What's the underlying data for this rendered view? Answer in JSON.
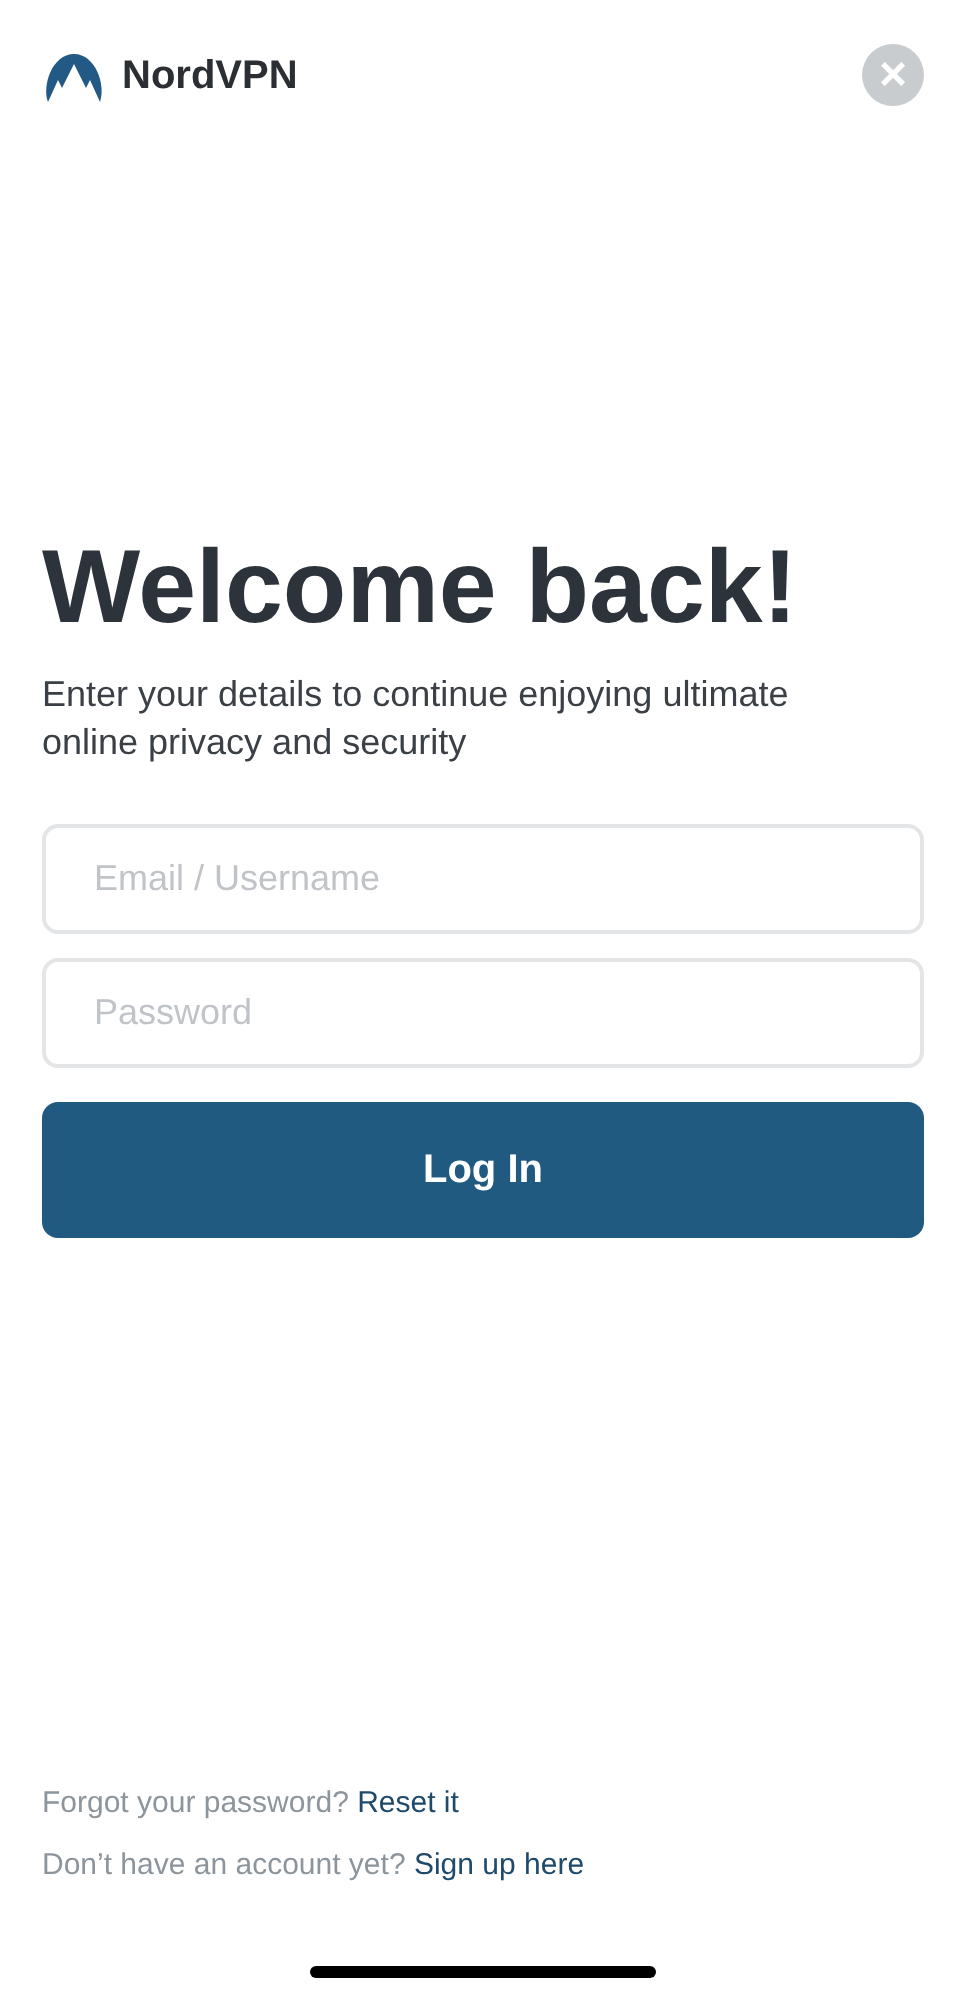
{
  "header": {
    "brand": "NordVPN",
    "close": "×"
  },
  "title": "Welcome back!",
  "subtitle": "Enter your details to continue enjoying ultimate online privacy and security",
  "fields": [
    {
      "placeholder": "Email / Username"
    },
    {
      "placeholder": "Password"
    }
  ],
  "login_button": "Log In",
  "footer": [
    {
      "text": "Forgot your password?",
      "link": "Reset it"
    },
    {
      "text": "Don’t have an account yet?",
      "link": "Sign up here"
    }
  ]
}
